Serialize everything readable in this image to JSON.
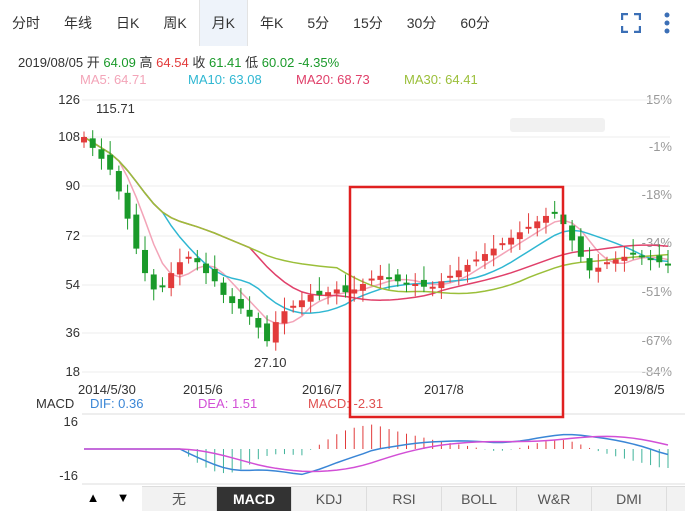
{
  "tabs": [
    "分时",
    "年线",
    "日K",
    "周K",
    "月K",
    "年K",
    "5分",
    "15分",
    "30分",
    "60分"
  ],
  "active_tab": "月K",
  "icons": {
    "fullscreen": "fullscreen-icon",
    "more": "more-vertical-icon"
  },
  "info": {
    "date": "2019/08/05",
    "open_label": "开",
    "open": "64.09",
    "high_label": "高",
    "high": "64.54",
    "close_label": "收",
    "close": "61.41",
    "low_label": "低",
    "low": "60.02",
    "change": "-4.35%"
  },
  "ma": [
    {
      "label": "MA5: 64.71",
      "color": "#f3a4b8"
    },
    {
      "label": "MA10: 63.08",
      "color": "#2fb7d2"
    },
    {
      "label": "MA20: 68.73",
      "color": "#e0406a"
    },
    {
      "label": "MA30: 64.41",
      "color": "#9bbf3a"
    }
  ],
  "y_left": [
    "126",
    "108",
    "90",
    "72",
    "54",
    "36",
    "18"
  ],
  "y_right": [
    "15%",
    "-1%",
    "-18%",
    "-34%",
    "-51%",
    "-67%",
    "-84%"
  ],
  "dates": [
    "2014/5/30",
    "2015/6",
    "2016/7",
    "2017/8",
    "2019/8/5"
  ],
  "annotations": {
    "high": "115.71",
    "low": "27.10"
  },
  "macd": {
    "label": "MACD",
    "dif": "DIF: 0.36",
    "dif_color": "#3a86d6",
    "dea": "DEA: 1.51",
    "dea_color": "#d24fd6",
    "macd": "MACD: -2.31",
    "macd_color": "#e05050",
    "y_top": "16",
    "y_bottom": "-16"
  },
  "bottom_tabs": [
    "无",
    "MACD",
    "KDJ",
    "RSI",
    "BOLL",
    "W&R",
    "DMI"
  ],
  "active_bottom_tab": "MACD",
  "colors": {
    "up": "#e23b3b",
    "down": "#1a9a2a",
    "highlight_box": "#e02020"
  }
}
